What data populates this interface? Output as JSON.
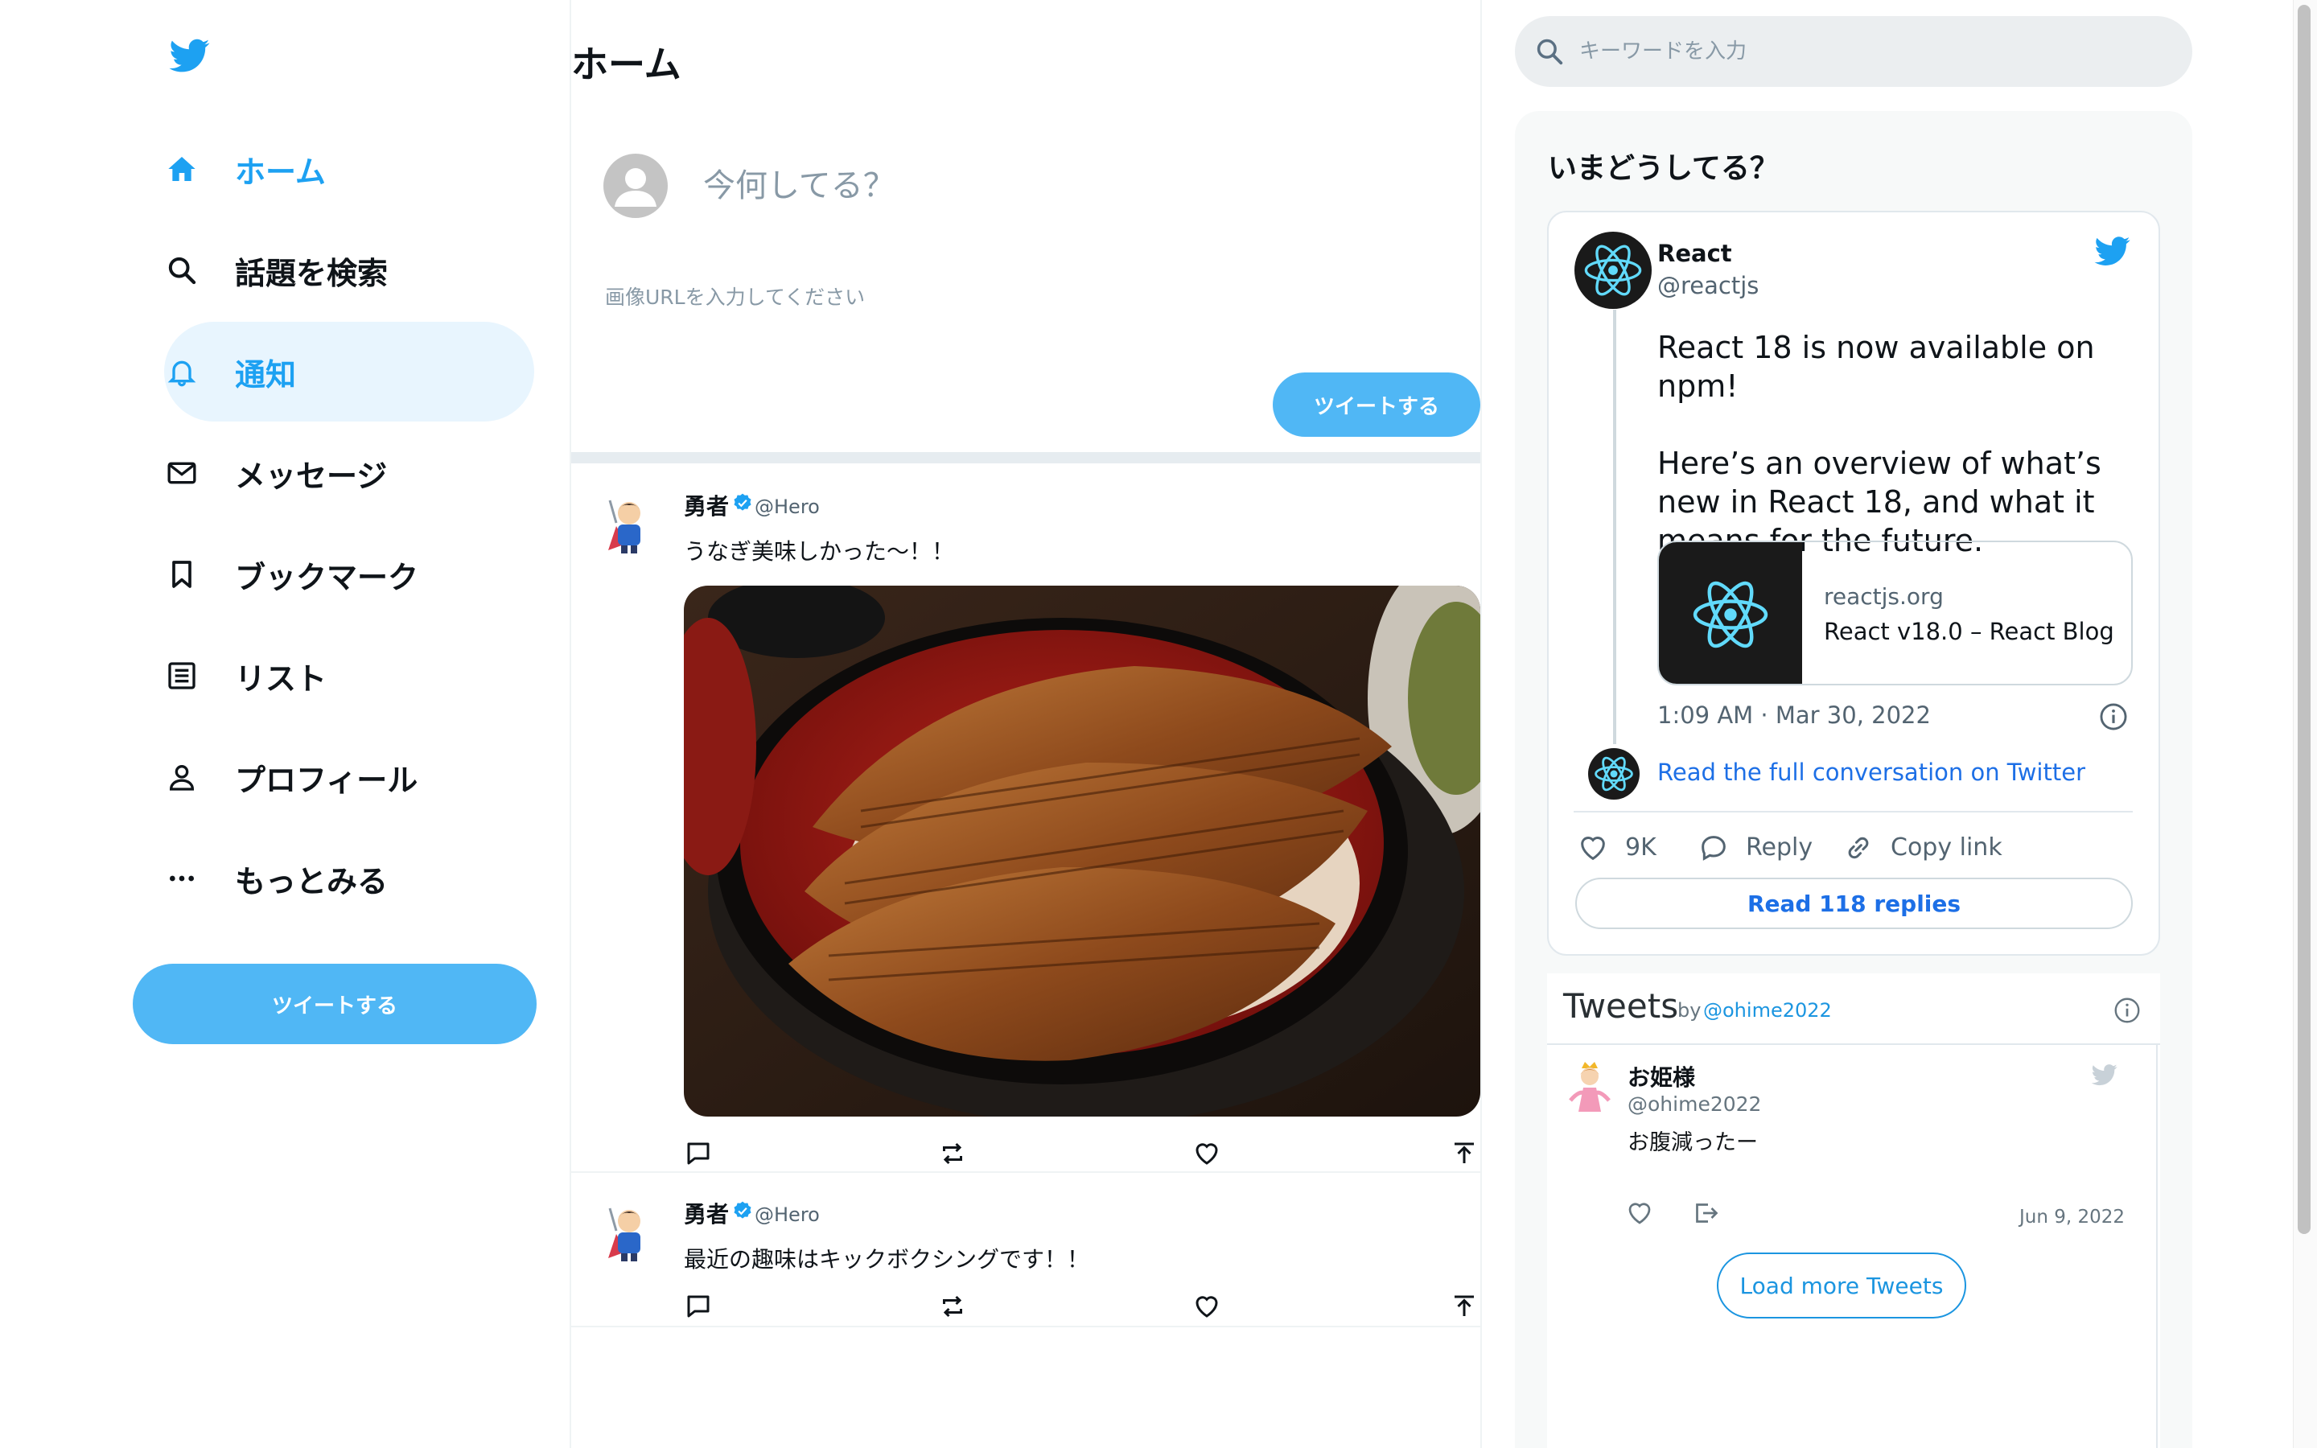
{
  "colors": {
    "accent": "#1da1f2",
    "button": "#50b7f5",
    "link": "#1d6fe6"
  },
  "sidebar": {
    "items": [
      {
        "label": "ホーム",
        "icon": "home-icon"
      },
      {
        "label": "話題を検索",
        "icon": "search-icon"
      },
      {
        "label": "通知",
        "icon": "bell-icon"
      },
      {
        "label": "メッセージ",
        "icon": "mail-icon"
      },
      {
        "label": "ブックマーク",
        "icon": "bookmark-icon"
      },
      {
        "label": "リスト",
        "icon": "list-icon"
      },
      {
        "label": "プロフィール",
        "icon": "person-icon"
      },
      {
        "label": "もっとみる",
        "icon": "more-icon"
      }
    ],
    "tweet_button": "ツイートする"
  },
  "feed": {
    "title": "ホーム",
    "compose": {
      "placeholder": "今何してる？",
      "url_placeholder": "画像URLを入力してください",
      "button": "ツイートする"
    },
    "posts": [
      {
        "name": "勇者",
        "handle": "@Hero",
        "text": "うなぎ美味しかった〜！！",
        "image": "unadon-photo"
      },
      {
        "name": "勇者",
        "handle": "@Hero",
        "text": "最近の趣味はキックボクシングです！！"
      }
    ]
  },
  "right": {
    "search_placeholder": "キーワードを入力",
    "trend_title": "いまどうしてる？",
    "embed": {
      "name": "React",
      "handle": "@reactjs",
      "paragraphs": [
        "React 18 is now available on npm!",
        "Here’s an overview of what’s new in React 18, and what it means for the future."
      ],
      "link_domain": "reactjs.org",
      "link_title": "React v18.0 – React Blog",
      "time": "1:09 AM · Mar 30, 2022",
      "read_full": "Read the full conversation on Twitter",
      "likes": "9K",
      "reply": "Reply",
      "copy_link": "Copy link",
      "read_replies": "Read 118 replies"
    },
    "timeline": {
      "header": "Tweets",
      "by": "by",
      "by_handle": "@ohime2022",
      "tweet": {
        "name": "お姫様",
        "handle": "@ohime2022",
        "text": "お腹減ったー",
        "date": "Jun 9, 2022"
      },
      "load_more": "Load more Tweets"
    }
  }
}
